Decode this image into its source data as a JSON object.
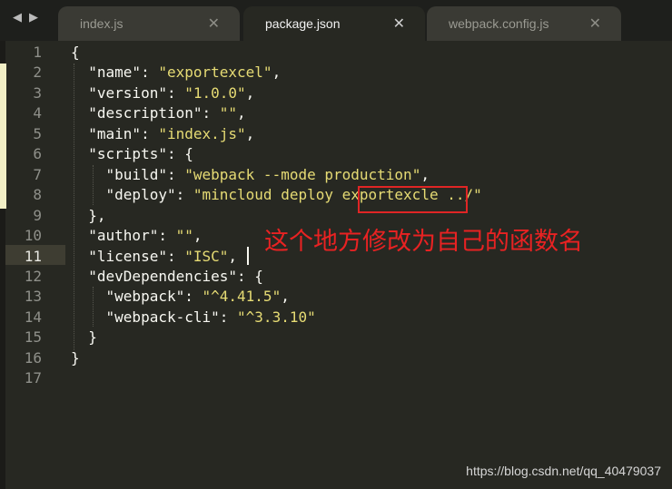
{
  "tabs": [
    {
      "label": "index.js",
      "close": "✕",
      "active": false
    },
    {
      "label": "package.json",
      "close": "✕",
      "active": true
    },
    {
      "label": "webpack.config.js",
      "close": "✕",
      "active": false
    }
  ],
  "editor": {
    "line_numbers": [
      "1",
      "2",
      "3",
      "4",
      "5",
      "6",
      "7",
      "8",
      "9",
      "10",
      "11",
      "12",
      "13",
      "14",
      "15",
      "16",
      "17"
    ],
    "current_line": 11,
    "lines": [
      [
        {
          "t": "p",
          "v": "{"
        }
      ],
      [
        {
          "t": "p",
          "v": "  "
        },
        {
          "t": "k",
          "v": "\"name\""
        },
        {
          "t": "p",
          "v": ": "
        },
        {
          "t": "s",
          "v": "\"exportexcel\""
        },
        {
          "t": "p",
          "v": ","
        }
      ],
      [
        {
          "t": "p",
          "v": "  "
        },
        {
          "t": "k",
          "v": "\"version\""
        },
        {
          "t": "p",
          "v": ": "
        },
        {
          "t": "s",
          "v": "\"1.0.0\""
        },
        {
          "t": "p",
          "v": ","
        }
      ],
      [
        {
          "t": "p",
          "v": "  "
        },
        {
          "t": "k",
          "v": "\"description\""
        },
        {
          "t": "p",
          "v": ": "
        },
        {
          "t": "s",
          "v": "\"\""
        },
        {
          "t": "p",
          "v": ","
        }
      ],
      [
        {
          "t": "p",
          "v": "  "
        },
        {
          "t": "k",
          "v": "\"main\""
        },
        {
          "t": "p",
          "v": ": "
        },
        {
          "t": "s",
          "v": "\"index.js\""
        },
        {
          "t": "p",
          "v": ","
        }
      ],
      [
        {
          "t": "p",
          "v": "  "
        },
        {
          "t": "k",
          "v": "\"scripts\""
        },
        {
          "t": "p",
          "v": ": {"
        }
      ],
      [
        {
          "t": "p",
          "v": "    "
        },
        {
          "t": "k",
          "v": "\"build\""
        },
        {
          "t": "p",
          "v": ": "
        },
        {
          "t": "s",
          "v": "\"webpack --mode production\""
        },
        {
          "t": "p",
          "v": ","
        }
      ],
      [
        {
          "t": "p",
          "v": "    "
        },
        {
          "t": "k",
          "v": "\"deploy\""
        },
        {
          "t": "p",
          "v": ": "
        },
        {
          "t": "s",
          "v": "\"mincloud deploy exportexcle ../\""
        }
      ],
      [
        {
          "t": "p",
          "v": "  },"
        }
      ],
      [
        {
          "t": "p",
          "v": "  "
        },
        {
          "t": "k",
          "v": "\"author\""
        },
        {
          "t": "p",
          "v": ": "
        },
        {
          "t": "s",
          "v": "\"\""
        },
        {
          "t": "p",
          "v": ","
        }
      ],
      [
        {
          "t": "p",
          "v": "  "
        },
        {
          "t": "k",
          "v": "\"license\""
        },
        {
          "t": "p",
          "v": ": "
        },
        {
          "t": "s",
          "v": "\"ISC\""
        },
        {
          "t": "p",
          "v": ","
        }
      ],
      [
        {
          "t": "p",
          "v": "  "
        },
        {
          "t": "k",
          "v": "\"devDependencies\""
        },
        {
          "t": "p",
          "v": ": {"
        }
      ],
      [
        {
          "t": "p",
          "v": "    "
        },
        {
          "t": "k",
          "v": "\"webpack\""
        },
        {
          "t": "p",
          "v": ": "
        },
        {
          "t": "s",
          "v": "\"^4.41.5\""
        },
        {
          "t": "p",
          "v": ","
        }
      ],
      [
        {
          "t": "p",
          "v": "    "
        },
        {
          "t": "k",
          "v": "\"webpack-cli\""
        },
        {
          "t": "p",
          "v": ": "
        },
        {
          "t": "s",
          "v": "\"^3.3.10\""
        }
      ],
      [
        {
          "t": "p",
          "v": "  }"
        }
      ],
      [
        {
          "t": "p",
          "v": "}"
        }
      ],
      []
    ]
  },
  "annotation": "这个地方修改为自己的函数名",
  "watermark": "https://blog.csdn.net/qq_40479037",
  "colors": {
    "background": "#272822",
    "string": "#e6db74",
    "text": "#f8f8f2",
    "annotation_red": "#e82222"
  }
}
